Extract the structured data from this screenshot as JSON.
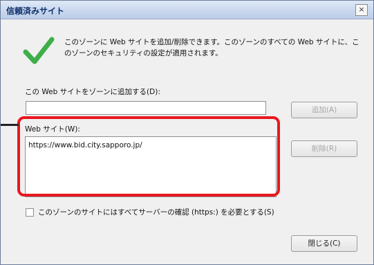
{
  "dialog": {
    "title": "信頼済みサイト",
    "close_glyph": "×",
    "info_text": "このゾーンに Web サイトを追加/削除できます。このゾーンのすべての Web サイトに、このゾーンのセキュリティの設定が適用されます。",
    "add_label": "この Web サイトをゾーンに追加する(D):",
    "add_input_value": "",
    "add_button": "追加(A)",
    "sites_label": "Web サイト(W):",
    "sites": [
      "https://www.bid.city.sapporo.jp/"
    ],
    "remove_button": "削除(R)",
    "https_label": "このゾーンのサイトにはすべてサーバーの確認 (https:) を必要とする(S)",
    "https_checked": false,
    "close_button": "閉じる(C)"
  },
  "colors": {
    "highlight": "#e8171f",
    "check_icon": "#3fae49"
  }
}
